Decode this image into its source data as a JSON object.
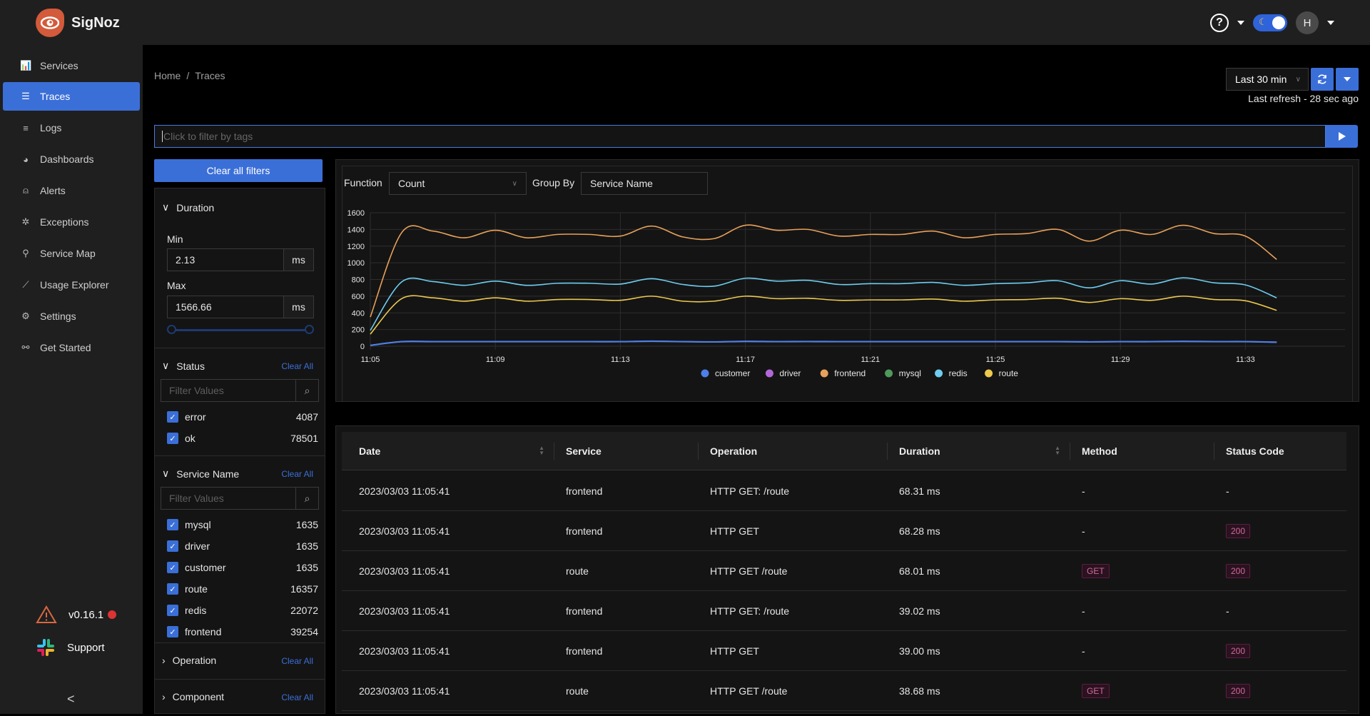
{
  "app": {
    "name": "SigNoz"
  },
  "header": {
    "help_icon": "question-circle-icon",
    "theme_toggle": "dark",
    "avatar_initial": "H"
  },
  "sidebar": {
    "items": [
      {
        "label": "Services",
        "icon": "bar-chart-icon",
        "glyph": "📊",
        "active": false
      },
      {
        "label": "Traces",
        "icon": "list-icon",
        "glyph": "☰",
        "active": true
      },
      {
        "label": "Logs",
        "icon": "align-left-icon",
        "glyph": "≡",
        "active": false
      },
      {
        "label": "Dashboards",
        "icon": "dashboard-icon",
        "glyph": "◕",
        "active": false
      },
      {
        "label": "Alerts",
        "icon": "alert-icon",
        "glyph": "⍝",
        "active": false
      },
      {
        "label": "Exceptions",
        "icon": "bug-icon",
        "glyph": "✲",
        "active": false
      },
      {
        "label": "Service Map",
        "icon": "deployment-unit-icon",
        "glyph": "⚲",
        "active": false
      },
      {
        "label": "Usage Explorer",
        "icon": "line-chart-icon",
        "glyph": "⟋",
        "active": false
      },
      {
        "label": "Settings",
        "icon": "gear-icon",
        "glyph": "⚙",
        "active": false
      },
      {
        "label": "Get Started",
        "icon": "api-icon",
        "glyph": "⚯",
        "active": false
      }
    ],
    "version": "v0.16.1",
    "support": "Support",
    "collapse": "<"
  },
  "breadcrumb": {
    "home": "Home",
    "sep": "/",
    "current": "Traces"
  },
  "time": {
    "selected": "Last 30 min",
    "last_refresh": "Last refresh - 28 sec ago"
  },
  "tag_filter": {
    "placeholder": "Click to filter by tags"
  },
  "filters": {
    "clear_all_label": "Clear all filters",
    "duration": {
      "title": "Duration",
      "min_label": "Min",
      "min_value": "2.13",
      "max_label": "Max",
      "max_value": "1566.66",
      "unit": "ms",
      "slider_range": [
        0,
        1
      ]
    },
    "status": {
      "title": "Status",
      "clear": "Clear All",
      "placeholder": "Filter Values",
      "items": [
        {
          "label": "error",
          "count": "4087",
          "checked": true
        },
        {
          "label": "ok",
          "count": "78501",
          "checked": true
        }
      ]
    },
    "service_name": {
      "title": "Service Name",
      "clear": "Clear All",
      "placeholder": "Filter Values",
      "items": [
        {
          "label": "mysql",
          "count": "1635",
          "checked": true
        },
        {
          "label": "driver",
          "count": "1635",
          "checked": true
        },
        {
          "label": "customer",
          "count": "1635",
          "checked": true
        },
        {
          "label": "route",
          "count": "16357",
          "checked": true
        },
        {
          "label": "redis",
          "count": "22072",
          "checked": true
        },
        {
          "label": "frontend",
          "count": "39254",
          "checked": true
        }
      ]
    },
    "operation": {
      "title": "Operation",
      "clear": "Clear All"
    },
    "component": {
      "title": "Component",
      "clear": "Clear All"
    }
  },
  "chart_controls": {
    "function_label": "Function",
    "function_value": "Count",
    "group_by_label": "Group By",
    "group_by_value": "Service Name"
  },
  "chart_data": {
    "type": "line",
    "title": "",
    "xlabel": "",
    "ylabel": "",
    "ylim": [
      0,
      1600
    ],
    "yticks": [
      0,
      200,
      400,
      600,
      800,
      1000,
      1200,
      1400,
      1600
    ],
    "x": [
      "11:05",
      "11:06",
      "11:07",
      "11:08",
      "11:09",
      "11:10",
      "11:11",
      "11:12",
      "11:13",
      "11:14",
      "11:15",
      "11:16",
      "11:17",
      "11:18",
      "11:19",
      "11:20",
      "11:21",
      "11:22",
      "11:23",
      "11:24",
      "11:25",
      "11:26",
      "11:27",
      "11:28",
      "11:29",
      "11:30",
      "11:31",
      "11:32",
      "11:33",
      "11:34"
    ],
    "xticks": [
      "11:05",
      "11:09",
      "11:13",
      "11:17",
      "11:21",
      "11:25",
      "11:29",
      "11:33"
    ],
    "grid": true,
    "legend_position": "bottom-center",
    "series": [
      {
        "name": "customer",
        "color": "#4e7fe6",
        "values": [
          10,
          55,
          55,
          55,
          55,
          55,
          55,
          55,
          55,
          60,
          55,
          52,
          58,
          55,
          56,
          55,
          55,
          55,
          55,
          55,
          55,
          55,
          55,
          52,
          55,
          55,
          58,
          55,
          55,
          48
        ]
      },
      {
        "name": "driver",
        "color": "#b267d8",
        "values": [
          10,
          55,
          55,
          55,
          55,
          55,
          55,
          55,
          55,
          60,
          55,
          52,
          58,
          55,
          56,
          55,
          55,
          55,
          55,
          55,
          55,
          55,
          55,
          52,
          55,
          55,
          58,
          55,
          55,
          48
        ]
      },
      {
        "name": "frontend",
        "color": "#e8a15a",
        "values": [
          350,
          1360,
          1380,
          1300,
          1390,
          1300,
          1340,
          1340,
          1320,
          1440,
          1310,
          1290,
          1450,
          1390,
          1400,
          1320,
          1340,
          1340,
          1380,
          1300,
          1340,
          1350,
          1400,
          1260,
          1390,
          1340,
          1450,
          1350,
          1320,
          1040
        ]
      },
      {
        "name": "mysql",
        "color": "#4f9a5b",
        "values": [
          10,
          55,
          55,
          55,
          55,
          55,
          55,
          55,
          55,
          60,
          55,
          52,
          58,
          55,
          56,
          55,
          55,
          55,
          55,
          55,
          55,
          55,
          55,
          52,
          55,
          55,
          58,
          55,
          55,
          48
        ]
      },
      {
        "name": "redis",
        "color": "#6ecdf0",
        "values": [
          190,
          770,
          775,
          730,
          780,
          730,
          755,
          755,
          745,
          810,
          740,
          720,
          815,
          780,
          790,
          740,
          750,
          750,
          765,
          730,
          750,
          760,
          785,
          700,
          785,
          745,
          820,
          760,
          735,
          580
        ]
      },
      {
        "name": "route",
        "color": "#edc94e",
        "values": [
          145,
          570,
          580,
          540,
          580,
          540,
          560,
          560,
          550,
          600,
          540,
          540,
          600,
          570,
          575,
          550,
          555,
          555,
          565,
          540,
          555,
          560,
          575,
          525,
          570,
          550,
          600,
          560,
          545,
          430
        ]
      }
    ]
  },
  "table": {
    "columns": [
      {
        "label": "Date",
        "sortable": true
      },
      {
        "label": "Service",
        "sortable": false
      },
      {
        "label": "Operation",
        "sortable": false
      },
      {
        "label": "Duration",
        "sortable": true
      },
      {
        "label": "Method",
        "sortable": false
      },
      {
        "label": "Status Code",
        "sortable": false
      }
    ],
    "rows": [
      {
        "date": "2023/03/03 11:05:41",
        "service": "frontend",
        "operation": "HTTP GET: /route",
        "duration": "68.31 ms",
        "method": "-",
        "status": "-"
      },
      {
        "date": "2023/03/03 11:05:41",
        "service": "frontend",
        "operation": "HTTP GET",
        "duration": "68.28 ms",
        "method": "-",
        "status": "200"
      },
      {
        "date": "2023/03/03 11:05:41",
        "service": "route",
        "operation": "HTTP GET /route",
        "duration": "68.01 ms",
        "method": "GET",
        "status": "200"
      },
      {
        "date": "2023/03/03 11:05:41",
        "service": "frontend",
        "operation": "HTTP GET: /route",
        "duration": "39.02 ms",
        "method": "-",
        "status": "-"
      },
      {
        "date": "2023/03/03 11:05:41",
        "service": "frontend",
        "operation": "HTTP GET",
        "duration": "39.00 ms",
        "method": "-",
        "status": "200"
      },
      {
        "date": "2023/03/03 11:05:41",
        "service": "route",
        "operation": "HTTP GET /route",
        "duration": "38.68 ms",
        "method": "GET",
        "status": "200"
      }
    ]
  }
}
